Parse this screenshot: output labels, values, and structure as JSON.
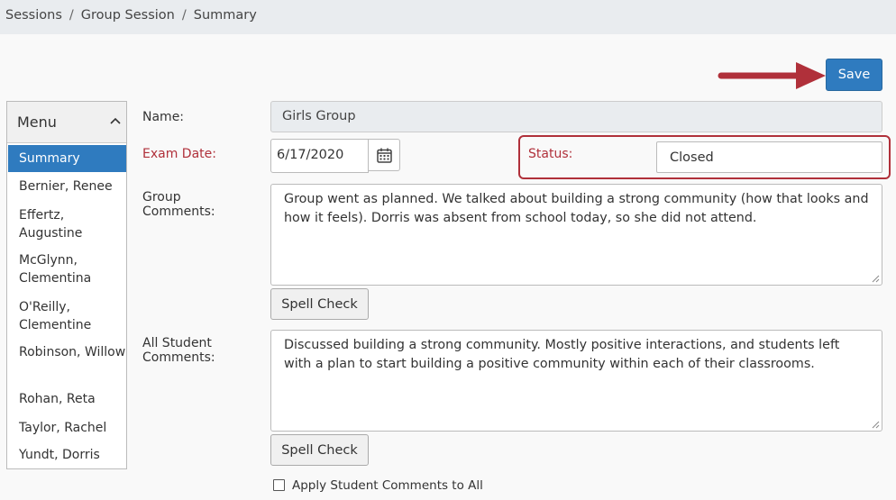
{
  "breadcrumb": {
    "items": [
      "Sessions",
      "Group Session",
      "Summary"
    ],
    "separator": "/"
  },
  "toolbar": {
    "save_label": "Save"
  },
  "menu": {
    "title": "Menu",
    "items": [
      {
        "label": "Summary",
        "active": true
      },
      {
        "label": "Bernier, Renee"
      },
      {
        "label": "Effertz, Augustine"
      },
      {
        "label": "McGlynn, Clementina"
      },
      {
        "label": "O'Reilly, Clementine"
      },
      {
        "label": "Robinson, Willow"
      },
      {
        "label": "Rohan, Reta"
      },
      {
        "label": "Taylor, Rachel"
      },
      {
        "label": "Yundt, Dorris"
      }
    ]
  },
  "form": {
    "name_label": "Name:",
    "name_value": "Girls Group",
    "exam_date_label": "Exam Date:",
    "exam_date_value": "6/17/2020",
    "status_label": "Status:",
    "status_value": "Closed",
    "group_comments_label": "Group Comments:",
    "group_comments_value": "Group went as planned. We talked about building a strong community (how that looks and how it feels). Dorris was absent from school today, so she did not attend.",
    "spell_check_label": "Spell Check",
    "student_comments_label": "All Student Comments:",
    "student_comments_value": "Discussed building a strong community. Mostly positive interactions, and students left with a plan to start building a positive community within each of their classrooms.",
    "apply_all_label": "Apply Student Comments to All",
    "apply_all_checked": false
  },
  "colors": {
    "primary": "#2f7bbf",
    "highlight": "#b0303a"
  }
}
